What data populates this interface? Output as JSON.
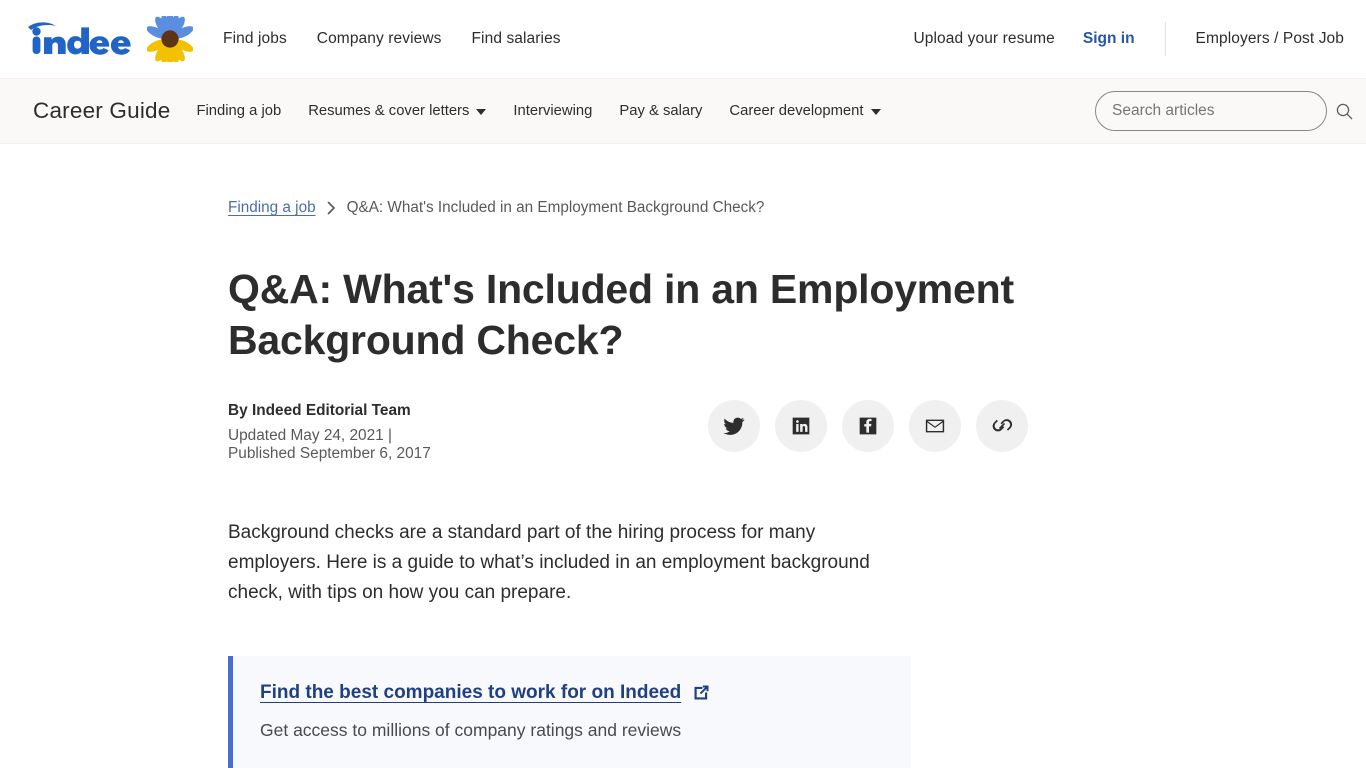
{
  "global_nav": {
    "logo_alt": "indeed",
    "links": [
      {
        "label": "Find jobs"
      },
      {
        "label": "Company reviews"
      },
      {
        "label": "Find salaries"
      }
    ],
    "upload_resume": "Upload your resume",
    "sign_in": "Sign in",
    "employers": "Employers / Post Job"
  },
  "career_nav": {
    "title": "Career Guide",
    "links": [
      {
        "label": "Finding a job",
        "has_caret": false
      },
      {
        "label": "Resumes & cover letters",
        "has_caret": true
      },
      {
        "label": "Interviewing",
        "has_caret": false
      },
      {
        "label": "Pay & salary",
        "has_caret": false
      },
      {
        "label": "Career development",
        "has_caret": true
      }
    ],
    "search_placeholder": "Search articles",
    "search_value": ""
  },
  "article": {
    "breadcrumb": {
      "parent": "Finding a job",
      "separator": "›",
      "current": "Q&A: What's Included in an Employment Background Check?"
    },
    "title": "Q&A: What's Included in an Employment Background Check?",
    "author": "By Indeed Editorial Team",
    "dates": "Updated May 24, 2021 | Published September 6, 2017",
    "share_buttons": [
      {
        "name": "twitter"
      },
      {
        "name": "linkedin"
      },
      {
        "name": "facebook"
      },
      {
        "name": "email"
      },
      {
        "name": "copy-link"
      }
    ],
    "intro": "Background checks are a standard part of the hiring process for many employers. Here is a guide to what’s included in an employment background check, with tips on how you can prepare.",
    "callout": {
      "link_text": "Find the best companies to work for on Indeed",
      "subtitle": "Get access to millions of company ratings and reviews"
    }
  },
  "colors": {
    "indeed_blue": "#2557a7",
    "link_blue": "#204081",
    "callout_border": "#4a6fd4",
    "callout_bg": "#f8f9fd",
    "nav_bg": "#faf9f8",
    "text_dark": "#2d2d2d",
    "text_muted": "#595959"
  }
}
